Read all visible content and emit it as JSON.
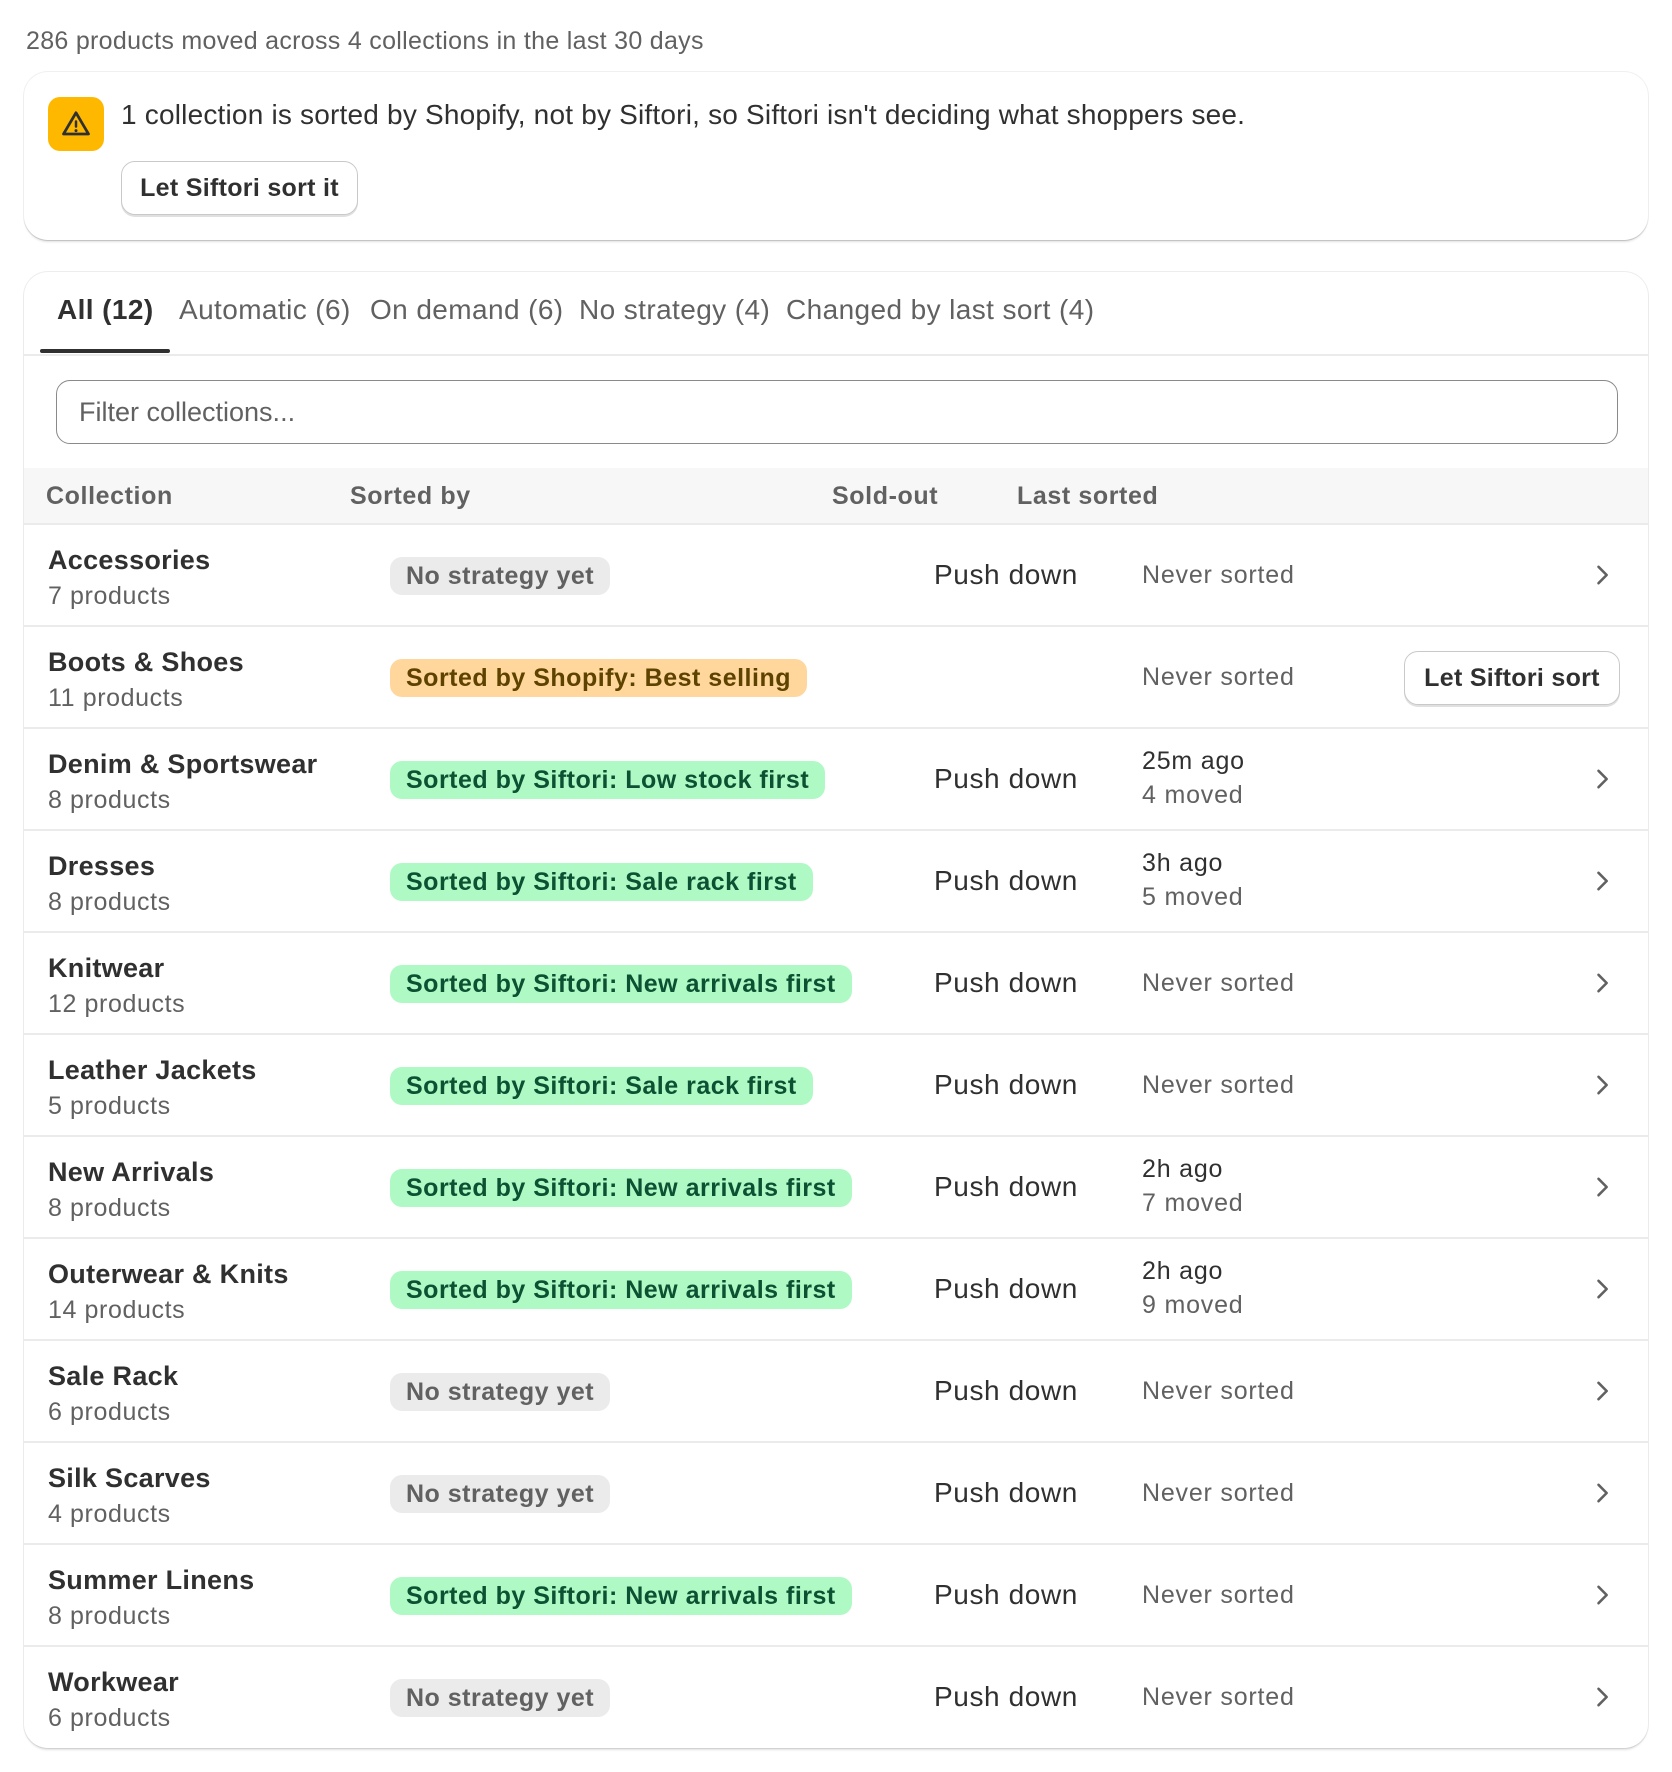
{
  "summary": "286 products moved across 4 collections in the last 30 days",
  "banner": {
    "message": "1 collection is sorted by Shopify, not by Siftori, so Siftori isn't deciding what shoppers see.",
    "button": "Let Siftori sort it",
    "icon": "alert-triangle-icon",
    "icon_bg": "#ffb800"
  },
  "tabs": [
    {
      "label": "All (12)",
      "active": true
    },
    {
      "label": "Automatic (6)"
    },
    {
      "label": "On demand (6)"
    },
    {
      "label": "No strategy (4)"
    },
    {
      "label": "Changed by last sort (4)"
    }
  ],
  "filter": {
    "placeholder": "Filter collections...",
    "value": ""
  },
  "table": {
    "headers": [
      "Collection",
      "Sorted by",
      "Sold-out",
      "Last sorted"
    ],
    "rows": [
      {
        "name": "Accessories",
        "count": "7 products",
        "sorted_by": "No strategy yet",
        "badge": "none",
        "soldout": "Push down",
        "last": "Never sorted",
        "moved": ""
      },
      {
        "name": "Boots & Shoes",
        "count": "11 products",
        "sorted_by": "Sorted by Shopify: Best selling",
        "badge": "shopify",
        "soldout": "",
        "last": "Never sorted",
        "moved": "",
        "action": "Let Siftori sort"
      },
      {
        "name": "Denim & Sportswear",
        "count": "8 products",
        "sorted_by": "Sorted by Siftori: Low stock first",
        "badge": "siftori",
        "soldout": "Push down",
        "last": "25m ago",
        "moved": "4 moved"
      },
      {
        "name": "Dresses",
        "count": "8 products",
        "sorted_by": "Sorted by Siftori: Sale rack first",
        "badge": "siftori",
        "soldout": "Push down",
        "last": "3h ago",
        "moved": "5 moved"
      },
      {
        "name": "Knitwear",
        "count": "12 products",
        "sorted_by": "Sorted by Siftori: New arrivals first",
        "badge": "siftori",
        "soldout": "Push down",
        "last": "Never sorted",
        "moved": ""
      },
      {
        "name": "Leather Jackets",
        "count": "5 products",
        "sorted_by": "Sorted by Siftori: Sale rack first",
        "badge": "siftori",
        "soldout": "Push down",
        "last": "Never sorted",
        "moved": ""
      },
      {
        "name": "New Arrivals",
        "count": "8 products",
        "sorted_by": "Sorted by Siftori: New arrivals first",
        "badge": "siftori",
        "soldout": "Push down",
        "last": "2h ago",
        "moved": "7 moved"
      },
      {
        "name": "Outerwear & Knits",
        "count": "14 products",
        "sorted_by": "Sorted by Siftori: New arrivals first",
        "badge": "siftori",
        "soldout": "Push down",
        "last": "2h ago",
        "moved": "9 moved"
      },
      {
        "name": "Sale Rack",
        "count": "6 products",
        "sorted_by": "No strategy yet",
        "badge": "none",
        "soldout": "Push down",
        "last": "Never sorted",
        "moved": ""
      },
      {
        "name": "Silk Scarves",
        "count": "4 products",
        "sorted_by": "No strategy yet",
        "badge": "none",
        "soldout": "Push down",
        "last": "Never sorted",
        "moved": ""
      },
      {
        "name": "Summer Linens",
        "count": "8 products",
        "sorted_by": "Sorted by Siftori: New arrivals first",
        "badge": "siftori",
        "soldout": "Push down",
        "last": "Never sorted",
        "moved": ""
      },
      {
        "name": "Workwear",
        "count": "6 products",
        "sorted_by": "No strategy yet",
        "badge": "none",
        "soldout": "Push down",
        "last": "Never sorted",
        "moved": ""
      }
    ]
  },
  "colors": {
    "badge_none_bg": "#ebebeb",
    "badge_shopify_bg": "#ffd79d",
    "badge_siftori_bg": "#aff9c5",
    "text_primary": "#303030",
    "text_secondary": "#616161"
  }
}
